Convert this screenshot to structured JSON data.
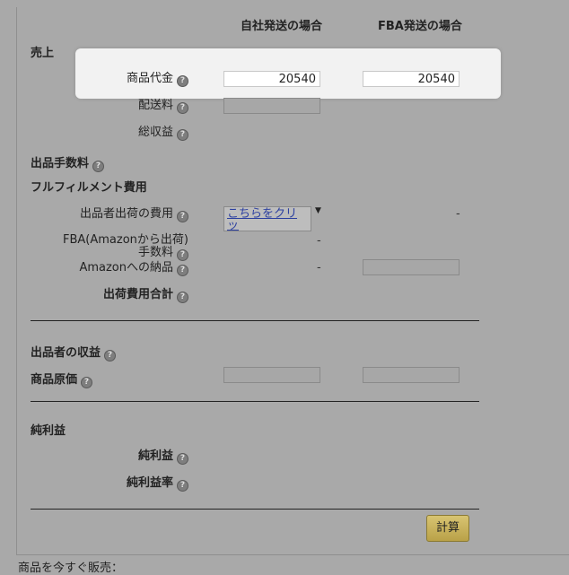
{
  "columns": {
    "own": "自社発送の場合",
    "fba": "FBA発送の場合"
  },
  "sections": {
    "sales": "売上",
    "selling_fee": "出品手数料",
    "fulfillment": "フルフィルメント費用",
    "seller_profit": "出品者の収益",
    "cost": "商品原価",
    "net_profit": "純利益"
  },
  "rows": {
    "item_price": {
      "label": "商品代金",
      "own_value": "20540",
      "fba_value": "20540"
    },
    "shipping": {
      "label": "配送料"
    },
    "total_revenue": {
      "label": "総収益"
    },
    "seller_ship_cost": {
      "label": "出品者出荷の費用",
      "link_line1": "こちらをクリッ",
      "link_line2": "ク",
      "fba_dash": "-"
    },
    "fba_fee": {
      "label_line1": "FBA(Amazonから出荷)",
      "label_line2": "手数料",
      "own_dash": "-"
    },
    "amazon_inbound": {
      "label": "Amazonへの納品",
      "own_dash": "-"
    },
    "shipping_total": {
      "label": "出荷費用合計"
    },
    "net_profit_value": {
      "label": "純利益"
    },
    "net_profit_rate": {
      "label": "純利益率"
    }
  },
  "help_glyph": "?",
  "caret_glyph": "▼",
  "calc_button": "計算",
  "footer_text": "商品を今すぐ販売："
}
